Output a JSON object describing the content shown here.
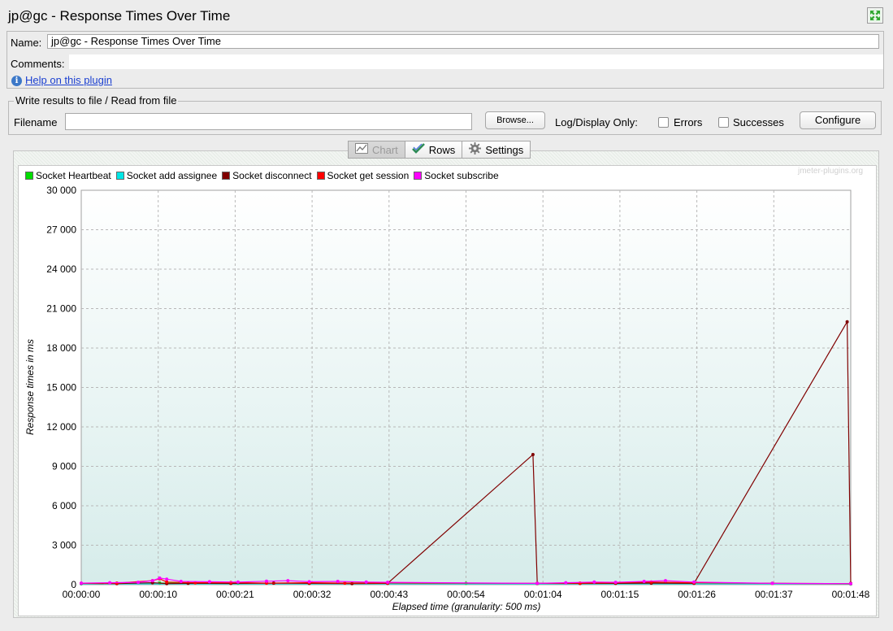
{
  "window": {
    "title": "jp@gc - Response Times Over Time"
  },
  "form": {
    "name_label": "Name:",
    "name_value": "jp@gc - Response Times Over Time",
    "comments_label": "Comments:",
    "help_link": "Help on this plugin"
  },
  "file_panel": {
    "legend": "Write results to file / Read from file",
    "filename_label": "Filename",
    "filename_value": "",
    "browse_label": "Browse...",
    "log_display_label": "Log/Display Only:",
    "errors_label": "Errors",
    "errors_checked": false,
    "successes_label": "Successes",
    "successes_checked": false,
    "configure_label": "Configure"
  },
  "tabs": [
    {
      "label": "Chart",
      "icon": "chart-icon",
      "selected": true
    },
    {
      "label": "Rows",
      "icon": "check-icon",
      "selected": false
    },
    {
      "label": "Settings",
      "icon": "gear-icon",
      "selected": false
    }
  ],
  "watermark": "jmeter-plugins.org",
  "chart_data": {
    "type": "line",
    "xlabel": "Elapsed time (granularity: 500 ms)",
    "ylabel": "Response times in ms",
    "x_unit": "seconds elapsed",
    "xlim": [
      0,
      108
    ],
    "ylim": [
      0,
      30000
    ],
    "x_ticks": [
      "00:00:00",
      "00:00:10",
      "00:00:21",
      "00:00:32",
      "00:00:43",
      "00:00:54",
      "00:01:04",
      "00:01:15",
      "00:01:26",
      "00:01:37",
      "00:01:48"
    ],
    "y_ticks": [
      "0",
      "3 000",
      "6 000",
      "9 000",
      "12 000",
      "15 000",
      "18 000",
      "21 000",
      "24 000",
      "27 000",
      "30 000"
    ],
    "grid": true,
    "legend_position": "top-left",
    "series": [
      {
        "name": "Socket Heartbeat",
        "color": "#00dd00",
        "x": [
          0,
          11,
          22,
          32,
          43,
          54,
          64,
          75,
          86,
          97,
          108
        ],
        "y": [
          100,
          120,
          110,
          100,
          150,
          100,
          80,
          100,
          150,
          100,
          50
        ]
      },
      {
        "name": "Socket add assignee",
        "color": "#00e6e6",
        "x": [
          0,
          108
        ],
        "y": [
          60,
          60
        ]
      },
      {
        "name": "Socket disconnect",
        "color": "#800000",
        "x": [
          0,
          5,
          10,
          12,
          15,
          21,
          27,
          32,
          38,
          43,
          63.4,
          64,
          70,
          75,
          80,
          86,
          107.5,
          108
        ],
        "y": [
          100,
          80,
          150,
          80,
          100,
          90,
          120,
          100,
          80,
          100,
          9900,
          100,
          90,
          100,
          120,
          100,
          20000,
          100
        ]
      },
      {
        "name": "Socket get session",
        "color": "#ff0000",
        "x": [
          0,
          5,
          10,
          11,
          12,
          16,
          21,
          26,
          32,
          37,
          43,
          64,
          70,
          75,
          80,
          86,
          97,
          108
        ],
        "y": [
          100,
          120,
          300,
          450,
          200,
          150,
          160,
          120,
          150,
          120,
          130,
          100,
          120,
          150,
          200,
          150,
          100,
          80
        ]
      },
      {
        "name": "Socket subscribe",
        "color": "#ff00ff",
        "x": [
          0,
          4,
          8,
          10,
          11,
          12,
          14,
          18,
          22,
          26,
          29,
          32,
          36,
          40,
          43,
          64,
          68,
          72,
          75,
          79,
          82,
          86,
          97,
          108
        ],
        "y": [
          120,
          150,
          180,
          300,
          500,
          420,
          250,
          220,
          200,
          260,
          300,
          220,
          250,
          200,
          180,
          100,
          150,
          200,
          180,
          250,
          300,
          200,
          100,
          80
        ]
      }
    ]
  }
}
